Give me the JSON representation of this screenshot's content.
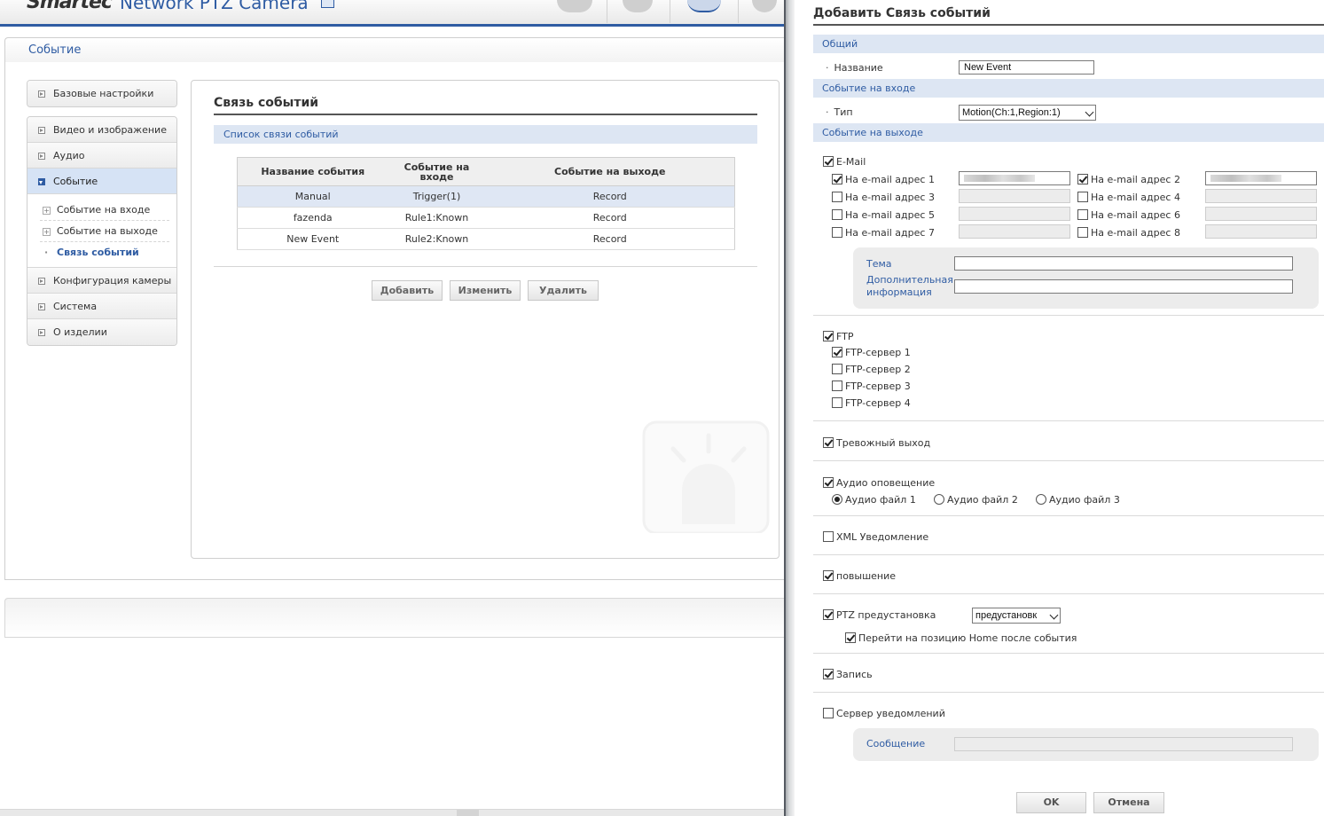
{
  "header": {
    "logo_text": "Smartec",
    "app_title": "Network PTZ Camera"
  },
  "breadcrumb": "Событие",
  "sidebar": {
    "basic": "Базовые настройки",
    "video": "Видео и изображение",
    "audio": "Аудио",
    "event": "Событие",
    "event_sub": {
      "input": "Событие на входе",
      "output": "Событие на выходе",
      "link": "Связь событий"
    },
    "camera_config": "Конфигурация камеры",
    "system": "Система",
    "about": "О изделии"
  },
  "panel": {
    "title": "Связь событий",
    "list_header": "Список связи событий",
    "columns": {
      "name": "Название события",
      "input": "Событие на входе",
      "output": "Событие на выходе"
    },
    "rows": [
      {
        "name": "Manual",
        "input": "Trigger(1)",
        "output": "Record"
      },
      {
        "name": "fazenda",
        "input": "Rule1:Known",
        "output": "Record"
      },
      {
        "name": "New Event",
        "input": "Rule2:Known",
        "output": "Record"
      }
    ],
    "buttons": {
      "add": "Добавить",
      "edit": "Изменить",
      "delete": "Удалить"
    }
  },
  "dialog": {
    "title": "Добавить Связь событий",
    "general": {
      "header": "Общий",
      "name_label": "Название",
      "name_value": "New Event"
    },
    "input_event": {
      "header": "Событие на входе",
      "type_label": "Тип",
      "type_value": "Motion(Ch:1,Region:1)"
    },
    "output_event": {
      "header": "Событие на выходе",
      "email": {
        "label": "E-Mail",
        "checked": true,
        "addresses": [
          {
            "label": "На e-mail адрес 1",
            "checked": true
          },
          {
            "label": "На e-mail адрес 2",
            "checked": true
          },
          {
            "label": "На e-mail адрес 3",
            "checked": false
          },
          {
            "label": "На e-mail адрес 4",
            "checked": false
          },
          {
            "label": "На e-mail адрес 5",
            "checked": false
          },
          {
            "label": "На e-mail адрес 6",
            "checked": false
          },
          {
            "label": "На e-mail адрес 7",
            "checked": false
          },
          {
            "label": "На e-mail адрес 8",
            "checked": false
          }
        ],
        "subject_label": "Тема",
        "extra_label_1": "Дополнительная",
        "extra_label_2": "информация"
      },
      "ftp": {
        "label": "FTP",
        "checked": true,
        "servers": [
          {
            "label": "FTP-сервер 1",
            "checked": true
          },
          {
            "label": "FTP-сервер 2",
            "checked": false
          },
          {
            "label": "FTP-сервер 3",
            "checked": false
          },
          {
            "label": "FTP-сервер 4",
            "checked": false
          }
        ]
      },
      "alarm_out": {
        "label": "Тревожный выход",
        "checked": true
      },
      "audio_alert": {
        "label": "Аудио оповещение",
        "checked": true,
        "files": [
          "Аудио файл 1",
          "Аудио файл 2",
          "Аудио файл 3"
        ],
        "selected_index": 0
      },
      "xml_notify": {
        "label": "XML Уведомление",
        "checked": false
      },
      "boost": {
        "label": "повышение",
        "checked": true
      },
      "ptz_preset": {
        "label": "PTZ предустановка",
        "checked": true,
        "select_value": "предустановк",
        "home_label": "Перейти на позицию Home после события",
        "home_checked": true
      },
      "record": {
        "label": "Запись",
        "checked": true
      },
      "notify_server": {
        "label": "Сервер уведомлений",
        "checked": false,
        "message_label": "Сообщение"
      }
    },
    "ok_label": "OK",
    "cancel_label": "Отмена"
  }
}
